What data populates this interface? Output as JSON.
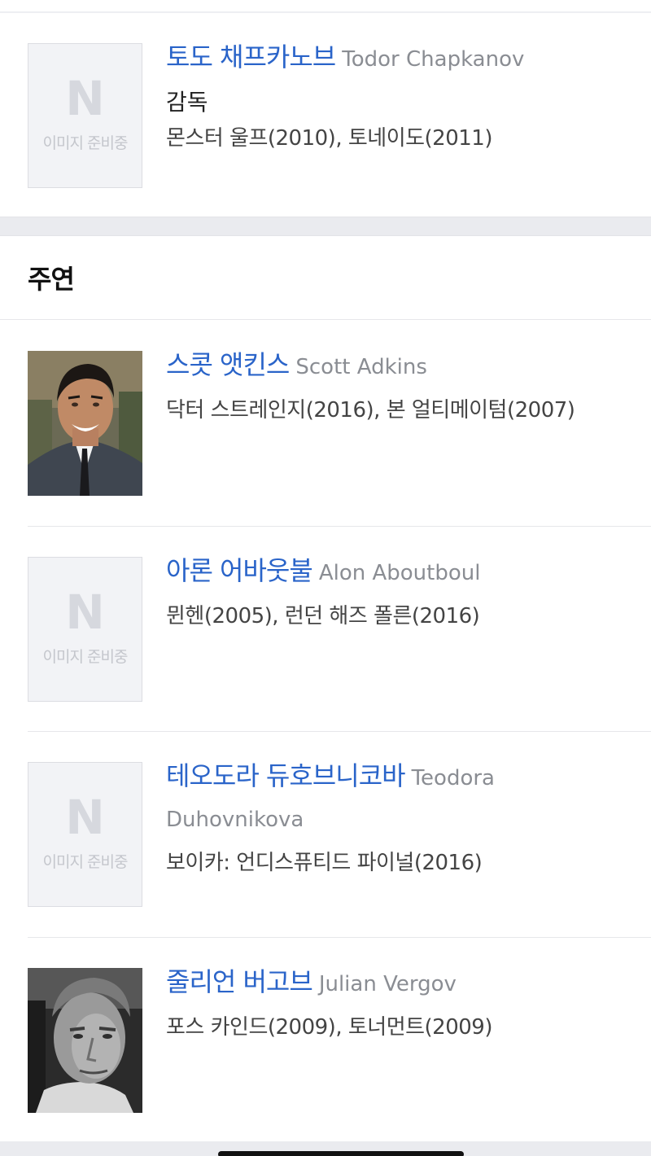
{
  "director": {
    "name_ko": "토도 채프카노브",
    "name_en": "Todor Chapkanov",
    "role": "감독",
    "works": "몬스터 울프(2010), 토네이도(2011)",
    "image": {
      "placeholder_letter": "N",
      "placeholder_text": "이미지 준비중"
    }
  },
  "cast_section": {
    "title": "주연"
  },
  "cast": [
    {
      "name_ko": "스콧 앳킨스",
      "name_en": "Scott Adkins",
      "works": "닥터 스트레인지(2016), 본 얼티메이텀(2007)",
      "has_photo": true
    },
    {
      "name_ko": "아론 어바웃불",
      "name_en": "Alon Aboutboul",
      "works": "뮌헨(2005), 런던 해즈 폴른(2016)",
      "has_photo": false,
      "placeholder_letter": "N",
      "placeholder_text": "이미지 준비중"
    },
    {
      "name_ko": "테오도라 듀호브니코바",
      "name_en": "Teodora Duhovnikova",
      "works": "보이카: 언디스퓨티드 파이널(2016)",
      "has_photo": false,
      "placeholder_letter": "N",
      "placeholder_text": "이미지 준비중"
    },
    {
      "name_ko": "줄리언 버고브",
      "name_en": "Julian Vergov",
      "works": "포스 카인드(2009), 토너먼트(2009)",
      "has_photo": true
    }
  ],
  "colors": {
    "name_link": "#2a64c9",
    "english_name": "#8a8d93",
    "section_gap": "#eaebef"
  }
}
